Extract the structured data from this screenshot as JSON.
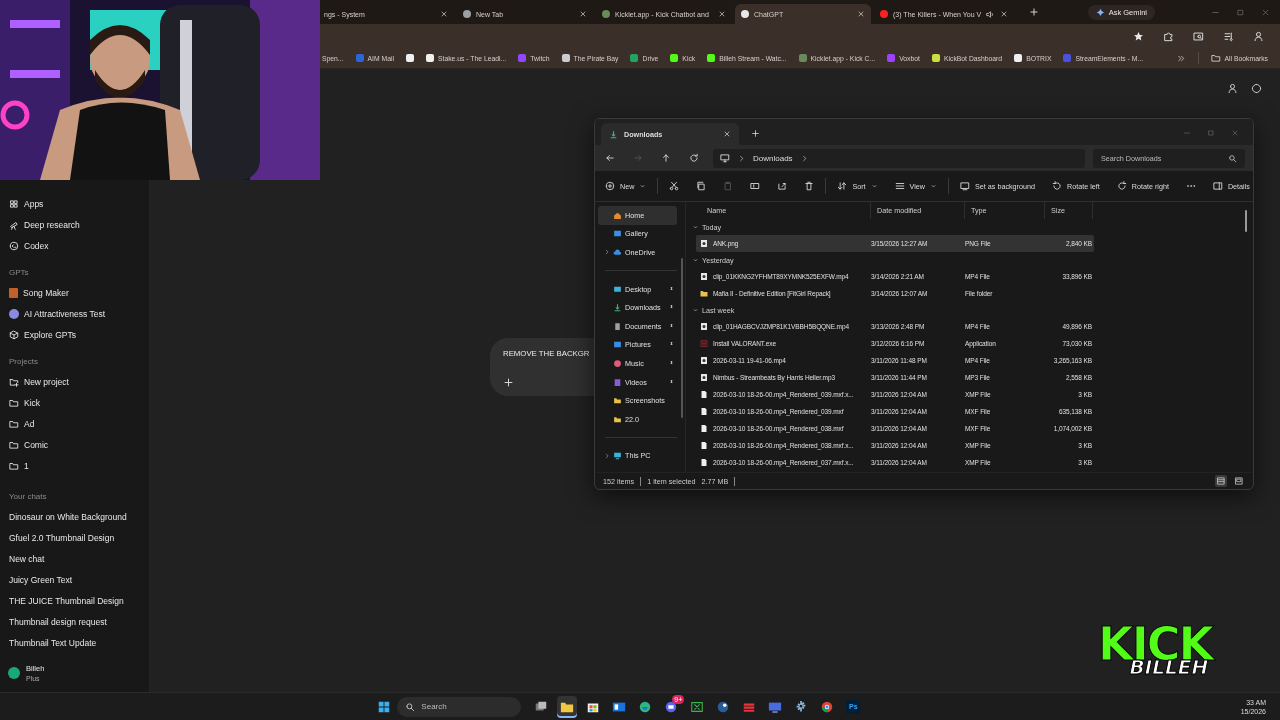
{
  "browser": {
    "tabs": [
      {
        "title": "ngs - System",
        "selected": false
      },
      {
        "title": "New Tab",
        "selected": false,
        "color": "#9aa0a6"
      },
      {
        "title": "Kicklet.app - Kick Chatbot and",
        "selected": false,
        "color": "#6a8a5a"
      },
      {
        "title": "ChatGPT",
        "selected": true,
        "color": "#e8e8e8"
      },
      {
        "title": "(3) The Killers - When You V",
        "selected": false,
        "color": "#ff2020",
        "audio": true
      }
    ],
    "ask_gemini": "Ask Gemini",
    "bookmarks": [
      {
        "kind": "link",
        "label": "Spen..."
      },
      {
        "kind": "link",
        "label": "AIM Mail",
        "color": "#2b66d9"
      },
      {
        "kind": "icon",
        "color": "#f0f0f0"
      },
      {
        "kind": "link",
        "label": "Stake.us - The Leadi...",
        "color": "#f0f0f0"
      },
      {
        "kind": "link",
        "label": "Twitch",
        "color": "#9146ff"
      },
      {
        "kind": "link",
        "label": "The Pirate Bay",
        "color": "#cccccc"
      },
      {
        "kind": "link",
        "label": "Drive",
        "color": "#1fa463"
      },
      {
        "kind": "link",
        "label": "Kick",
        "color": "#53fc18"
      },
      {
        "kind": "link",
        "label": "Billeh Stream - Watc...",
        "color": "#53fc18"
      },
      {
        "kind": "link",
        "label": "Kicklet.app - Kick C...",
        "color": "#6a8a5a"
      },
      {
        "kind": "link",
        "label": "Voxbot",
        "color": "#a040ff"
      },
      {
        "kind": "link",
        "label": "KickBot Dashboard",
        "color": "#c8e040"
      },
      {
        "kind": "link",
        "label": "BOTRIX",
        "color": "#f0f0f0"
      },
      {
        "kind": "link",
        "label": "StreamElements - M...",
        "color": "#4a50e0"
      }
    ],
    "all_bookmarks": "All Bookmarks"
  },
  "sidebar": {
    "nav": [
      {
        "kind": "apps",
        "label": "Apps"
      },
      {
        "kind": "research",
        "label": "Deep research"
      },
      {
        "kind": "codex",
        "label": "Codex"
      }
    ],
    "sections": [
      {
        "heading": "GPTs",
        "items": [
          {
            "kind": "song",
            "label": "Song Maker"
          },
          {
            "kind": "avatar",
            "label": "AI Attractiveness Test"
          },
          {
            "kind": "explore",
            "label": "Explore GPTs"
          }
        ]
      },
      {
        "heading": "Projects",
        "items": [
          {
            "kind": "new-project",
            "label": "New project"
          },
          {
            "kind": "folder",
            "label": "Kick"
          },
          {
            "kind": "folder",
            "label": "Ad"
          },
          {
            "kind": "folder",
            "label": "Comic"
          },
          {
            "kind": "folder",
            "label": "1"
          }
        ]
      }
    ],
    "chats_heading": "Your chats",
    "chats": [
      "Dinosaur on White Background",
      "Gfuel 2.0 Thumbnail Design",
      "New chat",
      "Juicy Green Text",
      "THE JUICE Thumbnail Design",
      "Thumbnail design request",
      "Thumbnail Text Update"
    ],
    "user": {
      "name": "Billeh",
      "plan": "Plus"
    }
  },
  "composer": {
    "text": "REMOVE THE BACKGR"
  },
  "explorer": {
    "tab": "Downloads",
    "breadcrumb": "Downloads",
    "search_placeholder": "Search Downloads",
    "toolbar": [
      {
        "kind": "new",
        "label": "New",
        "disabled": false
      },
      {
        "kind": "cut",
        "disabled": false
      },
      {
        "kind": "copy",
        "disabled": false
      },
      {
        "kind": "paste",
        "disabled": true
      },
      {
        "kind": "rename",
        "disabled": false
      },
      {
        "kind": "share",
        "disabled": false
      },
      {
        "kind": "delete",
        "disabled": false
      },
      {
        "kind": "sort",
        "label": "Sort",
        "disabled": false
      },
      {
        "kind": "view",
        "label": "View",
        "disabled": false
      },
      {
        "kind": "background",
        "label": "Set as background",
        "disabled": false
      },
      {
        "kind": "rotate-left",
        "label": "Rotate left",
        "disabled": false
      },
      {
        "kind": "rotate-right",
        "label": "Rotate right",
        "disabled": false
      },
      {
        "kind": "more",
        "disabled": false
      },
      {
        "kind": "details",
        "label": "Details",
        "disabled": false
      }
    ],
    "nav": [
      {
        "kind": "home",
        "label": "Home",
        "selected": true
      },
      {
        "kind": "gallery",
        "label": "Gallery",
        "selected": false
      },
      {
        "kind": "cloud",
        "label": "OneDrive",
        "selected": false,
        "expandable": true
      },
      {
        "kind": "divider"
      },
      {
        "kind": "desktop",
        "label": "Desktop",
        "selected": false,
        "pinned": true
      },
      {
        "kind": "download",
        "label": "Downloads",
        "selected": false,
        "pinned": true
      },
      {
        "kind": "document",
        "label": "Documents",
        "selected": false,
        "pinned": true
      },
      {
        "kind": "picture",
        "label": "Pictures",
        "selected": false,
        "pinned": true
      },
      {
        "kind": "music",
        "label": "Music",
        "selected": false,
        "pinned": true
      },
      {
        "kind": "video",
        "label": "Videos",
        "selected": false,
        "pinned": true
      },
      {
        "kind": "folder",
        "label": "Screenshots",
        "selected": false
      },
      {
        "kind": "folder",
        "label": "22.0",
        "selected": false
      },
      {
        "kind": "divider"
      },
      {
        "kind": "computer",
        "label": "This PC",
        "selected": false,
        "expandable": true
      }
    ],
    "columns": [
      "Name",
      "Date modified",
      "Type",
      "Size"
    ],
    "groups": [
      {
        "label": "Today",
        "rows": [
          {
            "kind": "media",
            "name": "ANK.png",
            "date": "3/15/2026 12:27 AM",
            "type": "PNG File",
            "size": "2,840 KB",
            "selected": true
          }
        ]
      },
      {
        "label": "Yesterday",
        "rows": [
          {
            "kind": "media",
            "name": "clip_01KKNG2YFHMT89XYMNK525EXFW.mp4",
            "date": "3/14/2026 2:21 AM",
            "type": "MP4 File",
            "size": "33,896 KB",
            "selected": false
          },
          {
            "kind": "folder",
            "name": "Mafia II - Definitive Edition [FitGirl Repack]",
            "date": "3/14/2026 12:07 AM",
            "type": "File folder",
            "selected": false
          }
        ]
      },
      {
        "label": "Last week",
        "rows": [
          {
            "kind": "media",
            "name": "clip_01HAGBCVJZMP81K1VBBH5BQQNE.mp4",
            "date": "3/13/2026 2:48 PM",
            "type": "MP4 File",
            "size": "49,896 KB",
            "selected": false
          },
          {
            "kind": "app",
            "name": "Install VALORANT.exe",
            "date": "3/12/2026 6:16 PM",
            "type": "Application",
            "size": "73,030 KB",
            "selected": false
          },
          {
            "kind": "media",
            "name": "2026-03-11 19-41-06.mp4",
            "date": "3/11/2026 11:48 PM",
            "type": "MP4 File",
            "size": "3,265,163 KB",
            "selected": false
          },
          {
            "kind": "media",
            "name": "Nimbus - Streambeats By Harris Heller.mp3",
            "date": "3/11/2026 11:44 PM",
            "type": "MP3 File",
            "size": "2,558 KB",
            "selected": false
          },
          {
            "kind": "file",
            "name": "2026-03-10 18-26-00.mp4_Rendered_039.mxf.x...",
            "date": "3/11/2026 12:04 AM",
            "type": "XMP File",
            "size": "3 KB",
            "selected": false
          },
          {
            "kind": "file",
            "name": "2026-03-10 18-26-00.mp4_Rendered_039.mxf",
            "date": "3/11/2026 12:04 AM",
            "type": "MXF File",
            "size": "635,138 KB",
            "selected": false
          },
          {
            "kind": "file",
            "name": "2026-03-10 18-26-00.mp4_Rendered_038.mxf",
            "date": "3/11/2026 12:04 AM",
            "type": "MXF File",
            "size": "1,074,002 KB",
            "selected": false
          },
          {
            "kind": "file",
            "name": "2026-03-10 18-26-00.mp4_Rendered_038.mxf.x...",
            "date": "3/11/2026 12:04 AM",
            "type": "XMP File",
            "size": "3 KB",
            "selected": false
          },
          {
            "kind": "file",
            "name": "2026-03-10 18-26-00.mp4_Rendered_037.mxf.x...",
            "date": "3/11/2026 12:04 AM",
            "type": "XMP File",
            "size": "3 KB",
            "selected": false
          }
        ]
      }
    ],
    "status": {
      "count": "152 items",
      "selection": "1 item selected",
      "size": "2.77 MB"
    }
  },
  "taskbar": {
    "search_placeholder": "Search",
    "apps": [
      {
        "kind": "taskview",
        "selected": false
      },
      {
        "kind": "explorer",
        "selected": true
      },
      {
        "kind": "store",
        "selected": false
      },
      {
        "kind": "mail",
        "selected": false
      },
      {
        "kind": "edge",
        "selected": false
      },
      {
        "kind": "discord",
        "selected": false,
        "badge": "9+"
      },
      {
        "kind": "xbox",
        "selected": false
      },
      {
        "kind": "steam",
        "selected": false
      },
      {
        "kind": "redapp",
        "selected": false
      },
      {
        "kind": "monitor",
        "selected": false
      },
      {
        "kind": "settings",
        "selected": false
      },
      {
        "kind": "chrome",
        "selected": false
      },
      {
        "kind": "ps",
        "selected": false,
        "label": "Ps"
      }
    ],
    "time": "33 AM",
    "date": "15/2026"
  },
  "overlay_logo": {
    "top": "KICK",
    "bottom": "BILLEH"
  }
}
